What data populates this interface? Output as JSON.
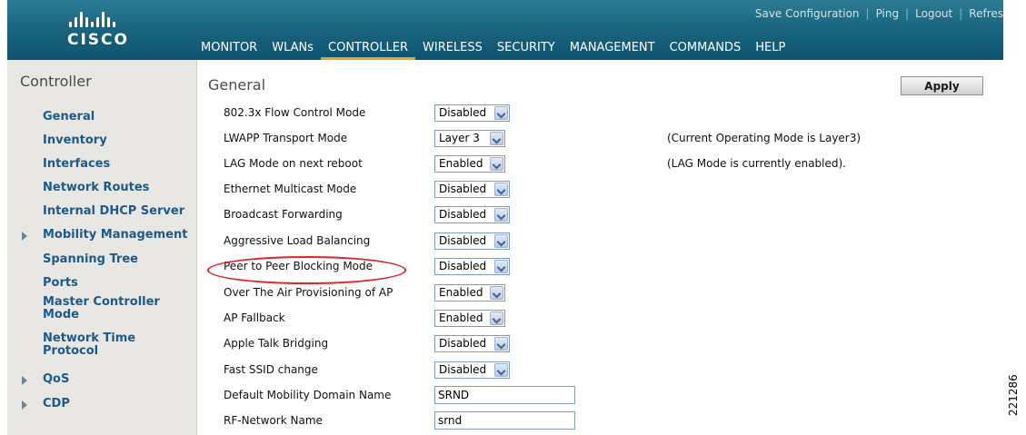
{
  "header": {
    "logo_text": "CISCO",
    "utility_links": [
      "Save Configuration",
      "Ping",
      "Logout",
      "Refres"
    ],
    "nav": [
      {
        "label": "MONITOR",
        "active": false
      },
      {
        "label": "WLANs",
        "active": false
      },
      {
        "label": "CONTROLLER",
        "active": true
      },
      {
        "label": "WIRELESS",
        "active": false
      },
      {
        "label": "SECURITY",
        "active": false
      },
      {
        "label": "MANAGEMENT",
        "active": false
      },
      {
        "label": "COMMANDS",
        "active": false
      },
      {
        "label": "HELP",
        "active": false
      }
    ]
  },
  "sidebar": {
    "title": "Controller",
    "items": [
      {
        "label": "General",
        "expandable": false
      },
      {
        "label": "Inventory",
        "expandable": false
      },
      {
        "label": "Interfaces",
        "expandable": false
      },
      {
        "label": "Network Routes",
        "expandable": false
      },
      {
        "label": "Internal DHCP Server",
        "expandable": false
      },
      {
        "label": "Mobility Management",
        "expandable": true
      },
      {
        "label": "Spanning Tree",
        "expandable": false
      },
      {
        "label": "Ports",
        "expandable": false
      },
      {
        "label": "Master Controller Mode",
        "expandable": false
      },
      {
        "label": "Network Time Protocol",
        "expandable": false
      },
      {
        "label": "QoS",
        "expandable": true
      },
      {
        "label": "CDP",
        "expandable": true
      }
    ]
  },
  "main": {
    "title": "General",
    "apply_label": "Apply",
    "rows": [
      {
        "label": "802.3x Flow Control Mode",
        "type": "select",
        "value": "Disabled",
        "note": ""
      },
      {
        "label": "LWAPP Transport Mode",
        "type": "select",
        "value": "Layer 3",
        "note": "(Current Operating Mode is Layer3)"
      },
      {
        "label": "LAG Mode on next reboot",
        "type": "select",
        "value": "Enabled",
        "note": "(LAG Mode is currently enabled)."
      },
      {
        "label": "Ethernet Multicast Mode",
        "type": "select",
        "value": "Disabled",
        "note": ""
      },
      {
        "label": "Broadcast Forwarding",
        "type": "select",
        "value": "Disabled",
        "note": ""
      },
      {
        "label": "Aggressive Load Balancing",
        "type": "select",
        "value": "Disabled",
        "note": ""
      },
      {
        "label": "Peer to Peer Blocking Mode",
        "type": "select",
        "value": "Disabled",
        "note": ""
      },
      {
        "label": "Over The Air Provisioning of AP",
        "type": "select",
        "value": "Enabled",
        "note": ""
      },
      {
        "label": "AP Fallback",
        "type": "select",
        "value": "Enabled",
        "note": ""
      },
      {
        "label": "Apple Talk Bridging",
        "type": "select",
        "value": "Disabled",
        "note": ""
      },
      {
        "label": "Fast SSID change",
        "type": "select",
        "value": "Disabled",
        "note": ""
      },
      {
        "label": "Default Mobility Domain Name",
        "type": "text",
        "value": "SRND",
        "note": ""
      },
      {
        "label": "RF-Network Name",
        "type": "text",
        "value": "srnd",
        "note": ""
      }
    ]
  },
  "annotation": {
    "highlight_color": "#e0222a"
  },
  "figure_id": "221286",
  "colors": {
    "header": "#1a6580",
    "sidebar_link": "#1c5a8a",
    "active_tab_underline": "#f3a321",
    "sidebar_bg": "#e8e7e4"
  },
  "icons": {
    "logo": "cisco-bridge-logo",
    "expand": "triangle-right-icon",
    "dropdown": "chevron-down-icon"
  }
}
